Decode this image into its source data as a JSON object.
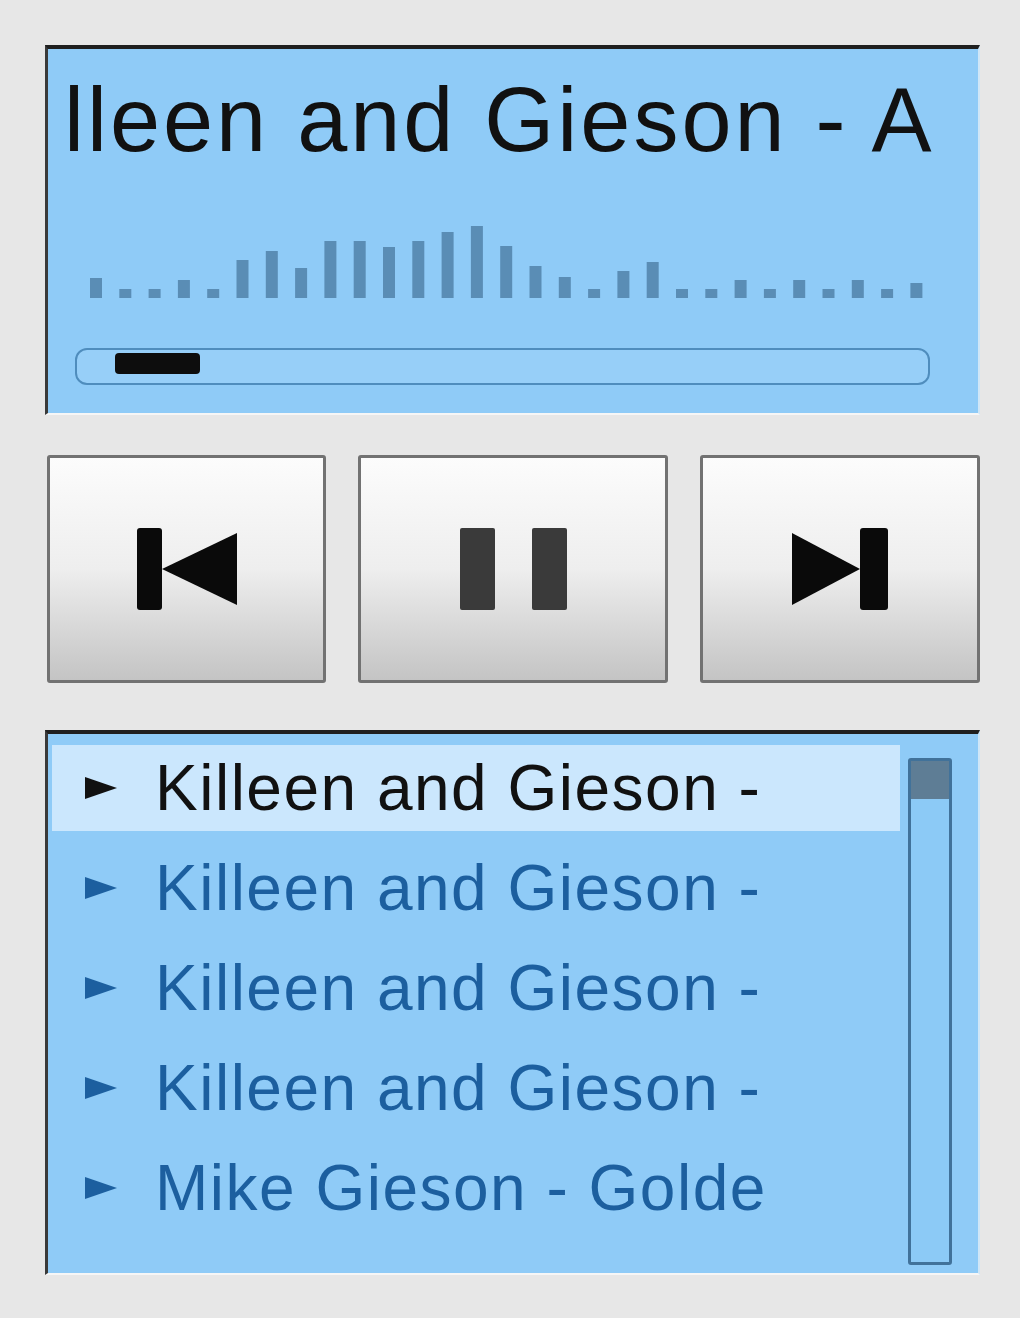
{
  "now_playing": {
    "title": "lleen and Gieson - A",
    "seek": {
      "level": 0.05
    }
  },
  "controls": [
    {
      "kind": "previous"
    },
    {
      "kind": "pause"
    },
    {
      "kind": "next"
    }
  ],
  "playlist": {
    "items": [
      {
        "title": "Killeen and Gieson -",
        "selected": true
      },
      {
        "title": "Killeen and Gieson -",
        "selected": false
      },
      {
        "title": "Killeen and Gieson -",
        "selected": false
      },
      {
        "title": "Killeen and Gieson -",
        "selected": false
      },
      {
        "title": "Mike Gieson - Golde",
        "selected": false
      }
    ]
  }
}
